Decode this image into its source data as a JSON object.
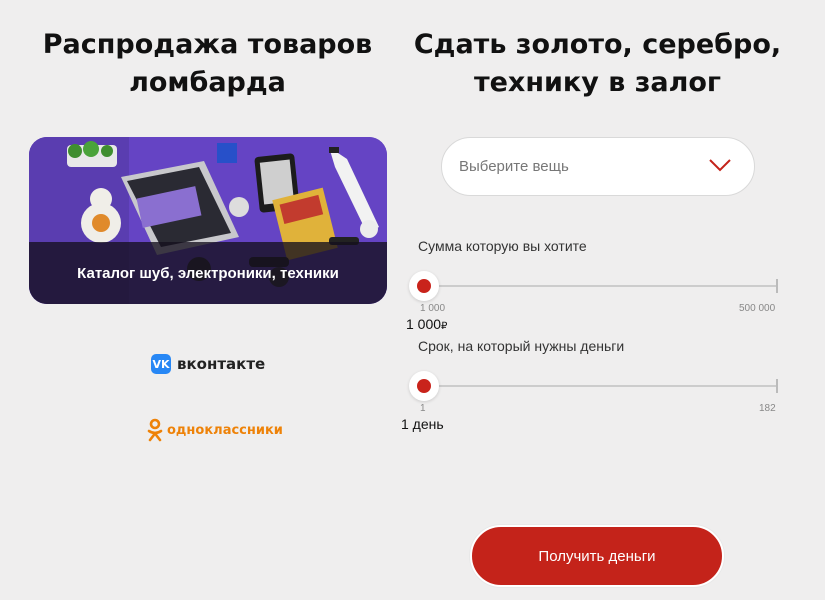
{
  "left": {
    "heading_line1": "Распродажа товаров",
    "heading_line2": "ломбарда",
    "catalog_label": "Каталог шуб, электроники, техники",
    "socials": {
      "vk_logo_text": "VK",
      "vk_text": "вконтакте",
      "ok_text": "одноклассники"
    }
  },
  "right": {
    "heading_line1": "Сдать золото, серебро,",
    "heading_line2": "технику в залог",
    "select_placeholder": "Выберите вещь",
    "amount": {
      "label": "Сумма которую вы хотите",
      "min": "1 000",
      "max": "500 000",
      "value": "1 000",
      "currency": "₽",
      "position_fraction": 0
    },
    "term": {
      "label": "Срок, на который нужны деньги",
      "min": "1",
      "max": "182",
      "value": "1 день",
      "position_fraction": 0
    },
    "submit_label": "Получить деньги"
  },
  "colors": {
    "accent": "#c4231a",
    "vk": "#2787f5",
    "ok": "#ee8208",
    "background": "#efeeee"
  }
}
